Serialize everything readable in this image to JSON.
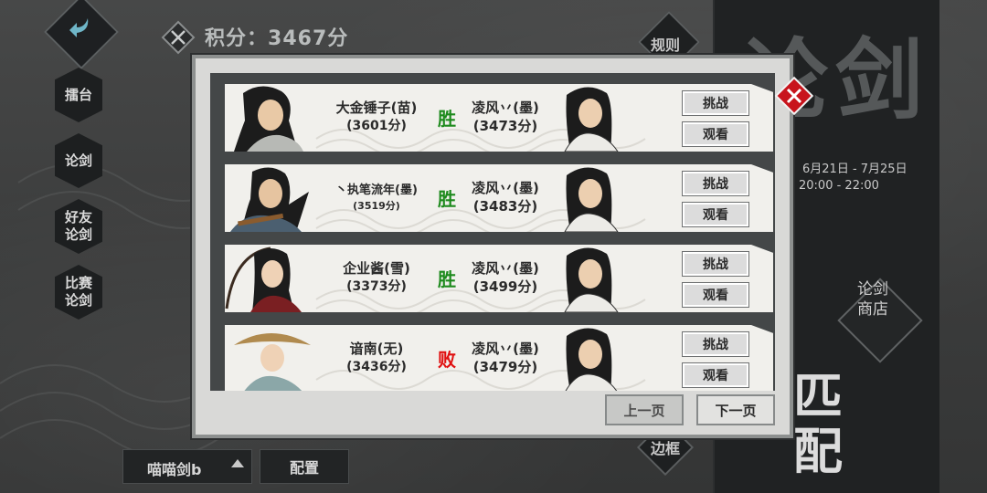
{
  "header": {
    "score_label": "积分：",
    "score_value": "3467分"
  },
  "nav": [
    {
      "label": "擂台"
    },
    {
      "label": "论剑"
    },
    {
      "label": "好友论剑"
    },
    {
      "label": "比赛论剑"
    }
  ],
  "right_panel": {
    "title": "论剑",
    "date": "6月21日 - 7月25日",
    "time": "20:00 - 22:00",
    "shop_label": "论剑商店",
    "match_label": "匹配"
  },
  "rules_label": "规则",
  "frame_label": "边框",
  "bottom": {
    "sword_select": "喵喵剑b",
    "config": "配置"
  },
  "records": [
    {
      "opponent": "大金锤子(苗)",
      "opponent_score": "(3601分)",
      "result": "胜",
      "self": "凌风丷(墨)",
      "self_score": "(3473分)",
      "challenge": "挑战",
      "watch": "观看"
    },
    {
      "opponent": "丶执笔流年(墨)",
      "opponent_score": "(3519分)",
      "result": "胜",
      "self": "凌风丷(墨)",
      "self_score": "(3483分)",
      "challenge": "挑战",
      "watch": "观看"
    },
    {
      "opponent": "企业酱(雪)",
      "opponent_score": "(3373分)",
      "result": "胜",
      "self": "凌风丷(墨)",
      "self_score": "(3499分)",
      "challenge": "挑战",
      "watch": "观看"
    },
    {
      "opponent": "谙南(无)",
      "opponent_score": "(3436分)",
      "result": "败",
      "self": "凌风丷(墨)",
      "self_score": "(3479分)",
      "challenge": "挑战",
      "watch": "观看"
    }
  ],
  "pager": {
    "prev": "上一页",
    "next": "下一页"
  },
  "colors": {
    "win": "#1d8a1d",
    "lose": "#e01010",
    "close": "#c8141c"
  },
  "icons": {
    "back": "back-arrow-icon",
    "score": "crossed-swords-icon",
    "close": "close-icon"
  }
}
